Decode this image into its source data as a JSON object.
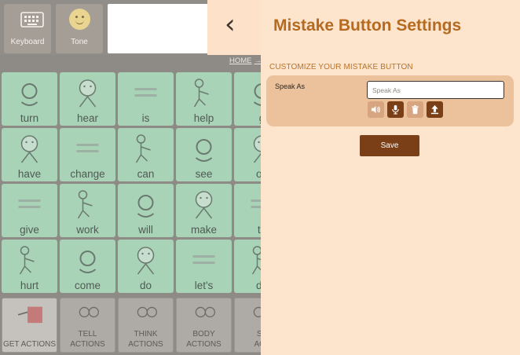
{
  "app": {
    "toolbar": {
      "keyboard_label": "Keyboard",
      "tone_label": "Tone",
      "back_glyph": "‹",
      "message_text": ""
    },
    "breadcrumb": {
      "home_label": "HOME",
      "separator": "→"
    },
    "words": [
      [
        "turn",
        "hear",
        "is",
        "help",
        "g"
      ],
      [
        "have",
        "change",
        "can",
        "see",
        "op"
      ],
      [
        "give",
        "work",
        "will",
        "make",
        "th"
      ],
      [
        "hurt",
        "come",
        "do",
        "let's",
        "do"
      ]
    ],
    "categories": [
      [
        "GET ACTIONS"
      ],
      [
        "TELL",
        "ACTIONS"
      ],
      [
        "THINK",
        "ACTIONS"
      ],
      [
        "BODY",
        "ACTIONS"
      ],
      [
        "SE",
        "ACT"
      ]
    ],
    "colors": {
      "word_cell": "#a9d3b7",
      "category_cell": "#aeaaa5",
      "overlay_background": "#8e8b86"
    }
  },
  "panel": {
    "title": "Mistake Button Settings",
    "section_title": "CUSTOMIZE YOUR MISTAKE BUTTON",
    "speak_as_label": "Speak As",
    "speak_as_placeholder": "Speak As",
    "speak_as_value": "",
    "icons": [
      "speaker-icon",
      "microphone-icon",
      "trash-icon",
      "upload-icon"
    ],
    "save_label": "Save",
    "colors": {
      "panel_bg": "#fde4cd",
      "accent": "#b56a1f",
      "card_bg": "#ebc29c",
      "button_bg": "#7a3f17"
    }
  }
}
